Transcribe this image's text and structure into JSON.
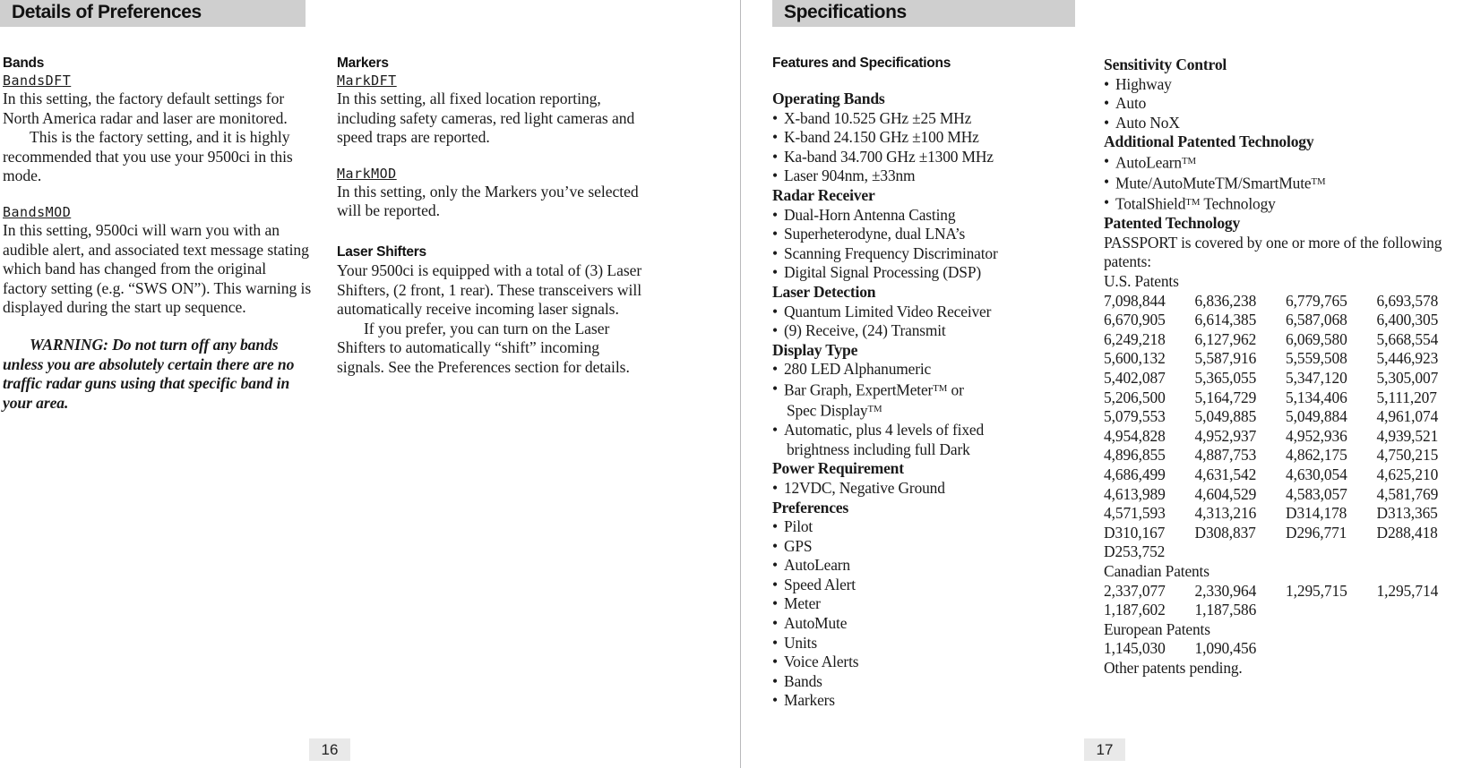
{
  "spread": {
    "left_page": {
      "running_head": "Details of Preferences",
      "folio": "16",
      "columns": [
        {
          "sections": [
            {
              "heading": "Bands",
              "setting_label": "BandsDFT",
              "paragraphs": [
                "In this setting, the factory default settings for North America radar and laser are monitored.",
                "This is the factory setting, and it is highly recommended that you use your 9500ci in this mode."
              ]
            },
            {
              "setting_label": "BandsMOD",
              "paragraphs": [
                "In this setting, 9500ci will warn you with an audible alert, and associated text message stating which band has changed from the original factory setting (e.g. “SWS ON”). This warning is displayed during the start up sequence."
              ],
              "warning": "WARNING: Do not turn off any bands unless you are absolutely certain there are no traffic radar guns using that specific band in your area."
            }
          ]
        },
        {
          "sections": [
            {
              "heading": "Markers",
              "setting_label": "MarkDFT",
              "paragraphs": [
                "In this setting, all fixed location reporting, including safety cameras, red light cameras and speed traps are reported."
              ]
            },
            {
              "setting_label": "MarkMOD",
              "paragraphs": [
                "In this setting, only the Markers you’ve selected will be reported."
              ]
            },
            {
              "heading": "Laser Shifters",
              "paragraphs": [
                "Your 9500ci is equipped with a total of (3) Laser Shifters, (2 front, 1 rear). These transceivers will automatically receive incoming laser signals.",
                "If you prefer, you can turn on the Laser Shifters to automatically “shift” incoming signals. See the Preferences section for details."
              ]
            }
          ]
        }
      ]
    },
    "right_page": {
      "running_head": "Specifications",
      "folio": "17",
      "section_title": "Features and Specifications",
      "column_left": [
        {
          "heading": "Operating Bands",
          "items": [
            "X-band 10.525 GHz ±25 MHz",
            "K-band 24.150 GHz ±100 MHz",
            "Ka-band 34.700 GHz ±1300 MHz",
            "Laser 904nm, ±33nm"
          ]
        },
        {
          "heading": "Radar Receiver",
          "items": [
            "Dual-Horn Antenna Casting",
            "Superheterodyne, dual LNA’s",
            "Scanning Frequency Discriminator",
            "Digital Signal Processing (DSP)"
          ]
        },
        {
          "heading": "Laser Detection",
          "items": [
            "Quantum Limited Video Receiver",
            "(9) Receive, (24) Transmit"
          ]
        },
        {
          "heading": "Display Type",
          "items": [
            "280 LED Alphanumeric",
            "Bar Graph, ExpertMeter™ or",
            "Spec Display™",
            "Automatic, plus 4 levels of fixed",
            "brightness including full Dark"
          ]
        },
        {
          "heading": "Power Requirement",
          "items": [
            "12VDC, Negative Ground"
          ]
        },
        {
          "heading": "Preferences",
          "items": [
            "Pilot",
            "GPS",
            "AutoLearn",
            "Speed Alert",
            "Meter",
            "AutoMute",
            "Units",
            "Voice Alerts",
            "Bands",
            "Markers"
          ]
        }
      ],
      "column_right": {
        "sensitivity": {
          "heading": "Sensitivity Control",
          "items": [
            "Highway",
            "Auto",
            "Auto NoX"
          ]
        },
        "additional_tech": {
          "heading": "Additional Patented Technology",
          "items": [
            "AutoLearn™",
            "Mute/AutoMuteTM/SmartMute™",
            "TotalShield™ Technology"
          ]
        },
        "patented_tech": {
          "heading": "Patented Technology",
          "intro": "PASSPORT is covered by one or more of the following patents:",
          "us_label": "U.S. Patents",
          "us_patents": [
            "7,098,844",
            "6,836,238",
            "6,779,765",
            "6,693,578",
            "6,670,905",
            "6,614,385",
            "6,587,068",
            "6,400,305",
            "6,249,218",
            "6,127,962",
            "6,069,580",
            "5,668,554",
            "5,600,132",
            "5,587,916",
            "5,559,508",
            "5,446,923",
            "5,402,087",
            "5,365,055",
            "5,347,120",
            "5,305,007",
            "5,206,500",
            "5,164,729",
            "5,134,406",
            "5,111,207",
            "5,079,553",
            "5,049,885",
            "5,049,884",
            "4,961,074",
            "4,954,828",
            "4,952,937",
            "4,952,936",
            "4,939,521",
            "4,896,855",
            "4,887,753",
            "4,862,175",
            "4,750,215",
            "4,686,499",
            "4,631,542",
            "4,630,054",
            "4,625,210",
            "4,613,989",
            "4,604,529",
            "4,583,057",
            "4,581,769",
            "4,571,593",
            "4,313,216",
            "D314,178",
            "D313,365",
            "D310,167",
            "D308,837",
            "D296,771",
            "D288,418",
            "D253,752"
          ],
          "canadian_label": "Canadian Patents",
          "canadian_patents": [
            "2,337,077",
            "2,330,964",
            "1,295,715",
            "1,295,714",
            "1,187,602",
            "1,187,586"
          ],
          "european_label": "European Patents",
          "european_patents": [
            "1,145,030",
            "1,090,456"
          ],
          "closing": "Other patents pending."
        }
      }
    }
  },
  "colors": {
    "head_bar": "#cfcfcf",
    "folio_bg": "#e9e9e9",
    "spine": "#b9b9bb",
    "text": "#1a1a1a"
  }
}
